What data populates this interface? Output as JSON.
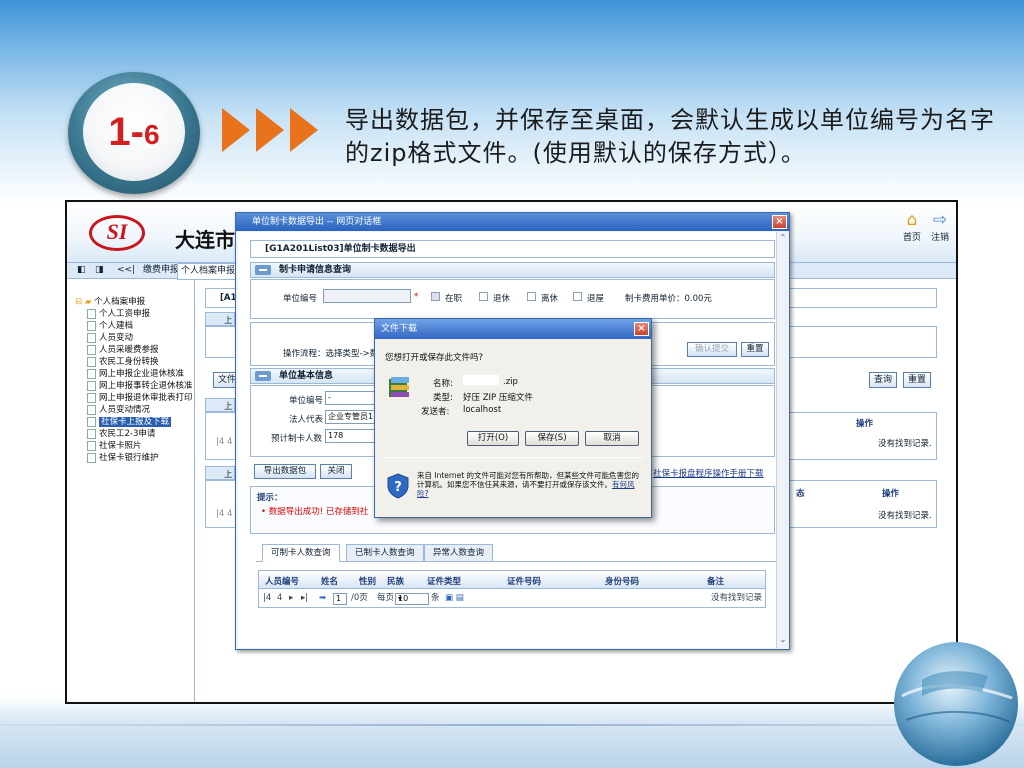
{
  "slide": {
    "step_main": "1-",
    "step_sub": "6",
    "heading": "导出数据包，并保存至桌面，会默认生成以单位编号为名字的zip格式文件。(使用默认的保存方式）。"
  },
  "app": {
    "logo_text": "SI",
    "title": "大连市",
    "home_label": "首页",
    "exit_label": "注销",
    "nav": {
      "prev": "<<|",
      "tab1": "缴费申报",
      "tab2": "个人档案申报"
    },
    "tree": {
      "root": "个人档案申报",
      "items": [
        "个人工资申报",
        "个人建档",
        "人员变动",
        "人员采暖费参报",
        "农民工身份转换",
        "网上申报企业退休核准",
        "网上申报事转企退休核准",
        "网上申报退休审批表打印",
        "人员变动情况",
        "社保卡上报及下载",
        "农民工2-3申请",
        "社保卡照片",
        "社保卡银行维护"
      ],
      "selected_index": 9
    },
    "bg": {
      "crumb": "[A1",
      "sec1": "上",
      "sec2": "上",
      "sec3": "上",
      "btn_doc": "文件",
      "query": "查询",
      "reset": "重置",
      "col_op": "操作",
      "col_status": "态",
      "no_record": "没有找到记录.",
      "pager": "|4 4"
    }
  },
  "dialog": {
    "title": "单位制卡数据导出 -- 网页对话框",
    "crumb": "[G1A201List03]单位制卡数据导出",
    "section1": "制卡申请信息查询",
    "unit_code_label": "单位编号",
    "unit_code_value": "",
    "required_mark": "*",
    "status_options": [
      "在职",
      "退休",
      "离休",
      "退屋"
    ],
    "fee_label": "制卡费用单价：0.00元",
    "process_label": "操作流程：选择类型->数",
    "confirm_btn": "确认提交",
    "reset_btn": "重置",
    "section2": "单位基本信息",
    "unit_no_label": "单位编号",
    "unit_no_value": "-",
    "legal_label": "法人代表",
    "legal_value": "企业专管员1",
    "plan_label": "预计制卡人数",
    "plan_value": "178",
    "export_btn": "导出数据包",
    "close_btn": "关闭",
    "manual_link": "社保卡报盘程序操作手册下载",
    "hint_title": "提示：",
    "hint_text": "• 数据导出成功! 已存储到社",
    "tabs": [
      "可制卡人数查询",
      "已制卡人数查询",
      "异常人数查询"
    ],
    "grid_cols": [
      "人员编号",
      "姓名",
      "性别",
      "民族",
      "证件类型",
      "证件号码",
      "身份号码",
      "备注"
    ],
    "pager": {
      "first": "|4",
      "prev": "4",
      "next": "▸",
      "last": "▸|",
      "go": "➡",
      "page": "1",
      "of": "/0页",
      "per": "每页",
      "size": "10",
      "unit": "条",
      "no_record": "没有找到记录"
    }
  },
  "file_dialog": {
    "title": "文件下载",
    "question": "您想打开或保存此文件吗?",
    "name_label": "名称:",
    "name_value": ".zip",
    "type_label": "类型:",
    "type_value": "好压 ZIP 压缩文件",
    "from_label": "发送者:",
    "from_value": "localhost",
    "open_btn": "打开(O)",
    "save_btn": "保存(S)",
    "cancel_btn": "取消",
    "warning": "来自 Internet 的文件可能对您有所帮助，但某些文件可能危害您的计算机。如果您不信任其来源，请不要打开或保存该文件。",
    "risk_link": "有何风险?"
  },
  "colors": {
    "accent_orange": "#e8731c",
    "step_red": "#d3201f",
    "title_blue": "#2a63c0"
  }
}
